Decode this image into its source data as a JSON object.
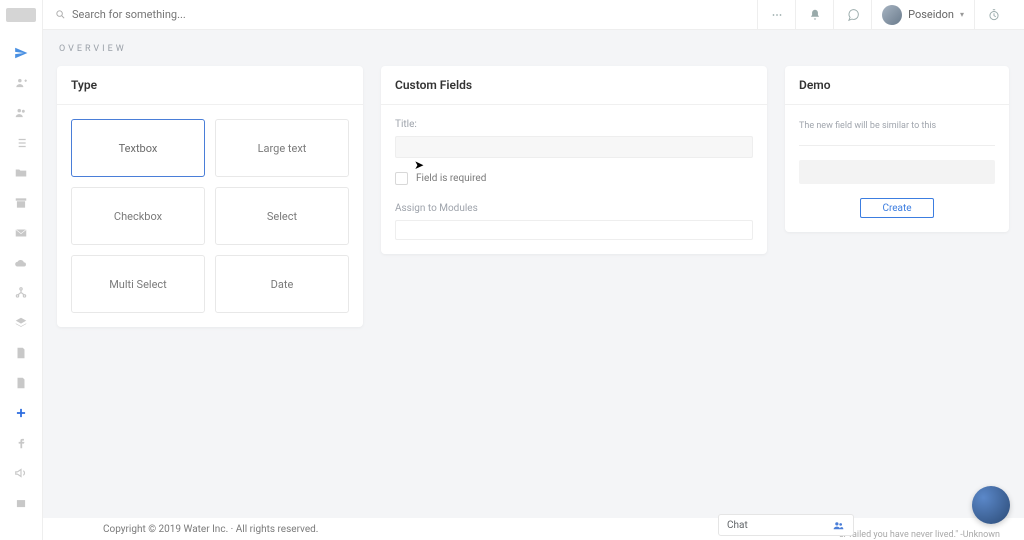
{
  "header": {
    "search_placeholder": "Search for something...",
    "user_name": "Poseidon"
  },
  "overview_label": "OVERVIEW",
  "type_card": {
    "title": "Type",
    "options": [
      "Textbox",
      "Large text",
      "Checkbox",
      "Select",
      "Multi Select",
      "Date"
    ],
    "selected_index": 0
  },
  "fields_card": {
    "title": "Custom Fields",
    "title_label": "Title:",
    "required_label": "Field is required",
    "assign_label": "Assign to Modules"
  },
  "demo_card": {
    "title": "Demo",
    "hint": "The new field will be similar to this",
    "create_label": "Create"
  },
  "chat_label": "Chat",
  "footer": "Copyright © 2019 Water Inc. · All rights reserved.",
  "quote": "er failed you have never lived.\" -Unknown"
}
